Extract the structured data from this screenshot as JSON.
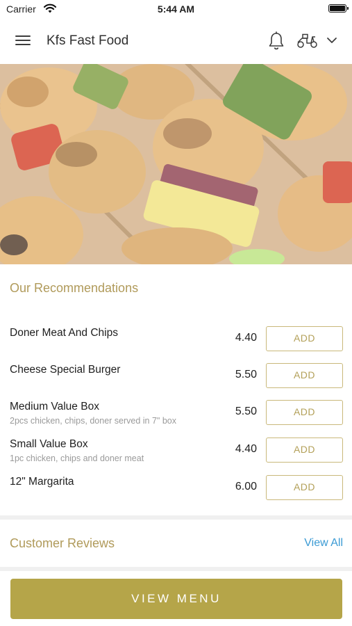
{
  "status_bar": {
    "carrier": "Carrier",
    "time": "5:44 AM"
  },
  "header": {
    "title": "Kfs Fast Food"
  },
  "recommendations": {
    "title": "Our Recommendations",
    "items": [
      {
        "name": "Doner Meat And Chips",
        "description": "",
        "price": "4.40",
        "button": "ADD"
      },
      {
        "name": "Cheese Special Burger",
        "description": "",
        "price": "5.50",
        "button": "ADD"
      },
      {
        "name": "Medium Value Box",
        "description": "2pcs chicken, chips, doner served in 7\" box",
        "price": "5.50",
        "button": "ADD"
      },
      {
        "name": "Small Value Box",
        "description": "1pc chicken, chips and doner meat",
        "price": "4.40",
        "button": "ADD"
      },
      {
        "name": "12\" Margarita",
        "description": "",
        "price": "6.00",
        "button": "ADD"
      }
    ]
  },
  "reviews": {
    "title": "Customer Reviews",
    "view_all": "View All"
  },
  "footer": {
    "button": "VIEW MENU"
  },
  "colors": {
    "accent": "#b5a549",
    "accent_text": "#b09a5a",
    "link": "#3a9ad4"
  },
  "icons": [
    "wifi-icon",
    "battery-icon",
    "hamburger-menu-icon",
    "bell-icon",
    "scooter-icon",
    "chevron-down-icon"
  ]
}
